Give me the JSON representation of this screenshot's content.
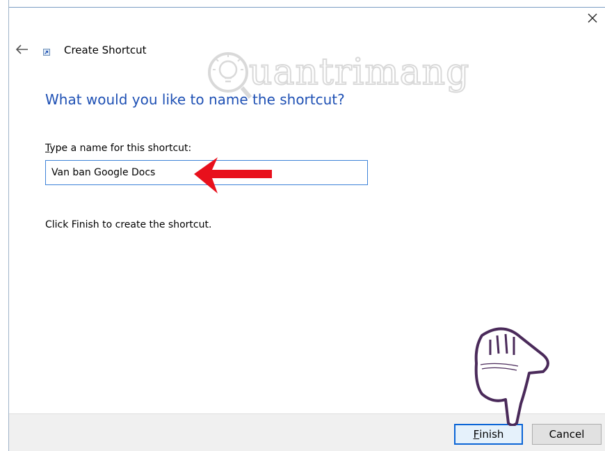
{
  "dialog": {
    "title": "Create Shortcut",
    "heading": "What would you like to name the shortcut?",
    "field_label_first": "T",
    "field_label_rest": "ype a name for this shortcut:",
    "name_value": "Van ban Google Docs",
    "instruction": "Click Finish to create the shortcut."
  },
  "buttons": {
    "finish_first": "F",
    "finish_rest": "inish",
    "cancel": "Cancel"
  },
  "watermark": {
    "text": "uantrimang"
  },
  "icons": {
    "close": "close-icon",
    "back": "back-arrow-icon",
    "app": "shortcut-app-icon",
    "annotation_arrow": "red-arrow-icon",
    "pointer": "pointing-hand-icon"
  },
  "colors": {
    "heading": "#1e50b4",
    "input_border": "#3d82d8",
    "focus_border": "#0a64d6",
    "annotation": "#e8101c"
  }
}
